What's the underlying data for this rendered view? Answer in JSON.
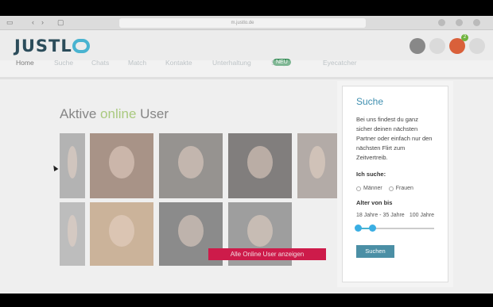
{
  "browser": {
    "url": "m.justlo.de"
  },
  "header": {
    "logo_text": "JUSTL",
    "menu": [
      {
        "label": "Home"
      },
      {
        "label": "Suche"
      },
      {
        "label": "Chats"
      },
      {
        "label": "Match"
      },
      {
        "label": "Kontakte"
      },
      {
        "label": "Unterhaltung"
      },
      {
        "label": "Shop",
        "badge": "NEU"
      },
      {
        "label": "Eyecatcher"
      }
    ],
    "notification_count": "2"
  },
  "main": {
    "title_part1": "Aktive ",
    "title_part2": "online",
    "title_part3": " User",
    "cta_label": "Alle Online User anzeigen"
  },
  "search_panel": {
    "title": "Suche",
    "description": "Bei uns findest du ganz sicher deinen nächsten Partner oder einfach nur den nächsten Flirt zum Zeitvertreib.",
    "ich_suche_label": "Ich suche:",
    "options": [
      "Männer",
      "Frauen"
    ],
    "age_label": "Alter von bis",
    "age_range_text": "18 Jahre - 35 Jahre",
    "age_max_text": "100 Jahre",
    "slider_min_value": 18,
    "slider_max_value": 35,
    "search_button": "Suchen"
  },
  "colors": {
    "accent_green": "#7cad3a",
    "cta_red": "#cd1b4a",
    "accent_blue": "#3f8fb0"
  }
}
